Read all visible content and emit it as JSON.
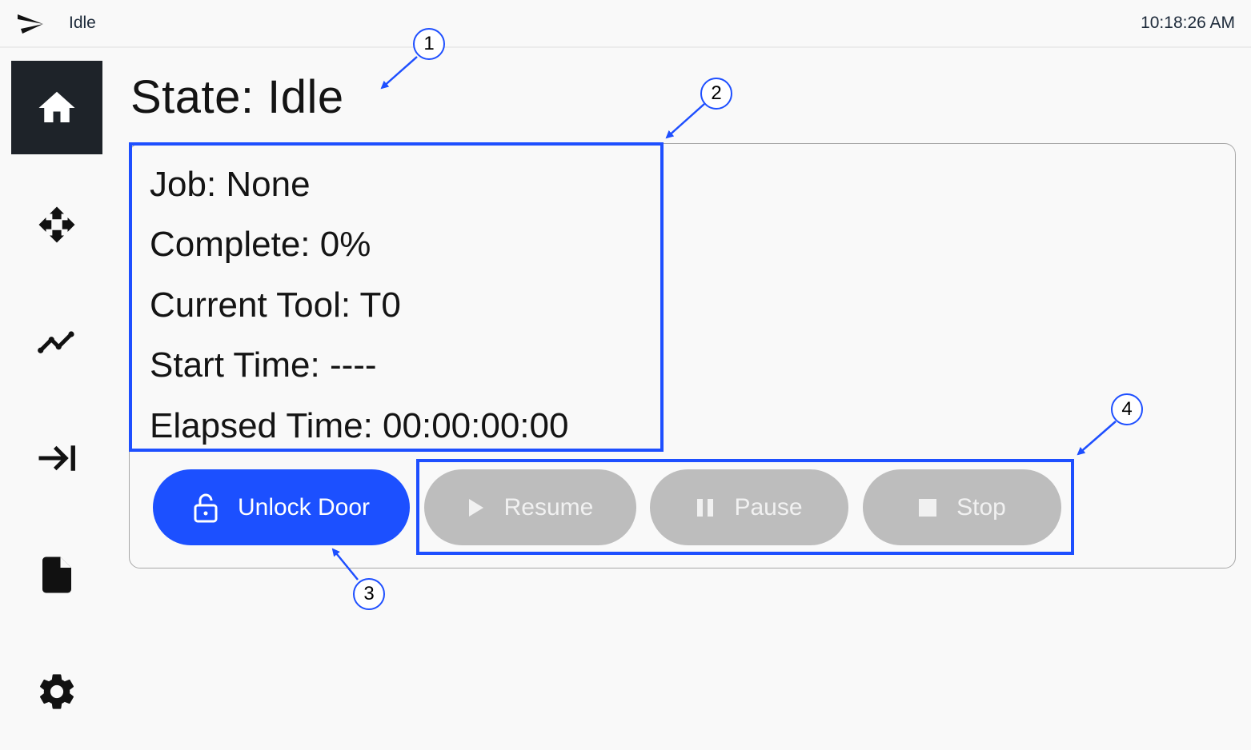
{
  "topbar": {
    "logo_icon": "paper-plane-logo-icon",
    "status": "Idle",
    "clock": "10:18:26 AM"
  },
  "sidebar": {
    "items": [
      {
        "name": "home",
        "icon": "home-icon",
        "active": true
      },
      {
        "name": "move",
        "icon": "move-arrows-icon",
        "active": false
      },
      {
        "name": "charts",
        "icon": "line-chart-icon",
        "active": false
      },
      {
        "name": "jog",
        "icon": "arrow-to-right-bar-icon",
        "active": false
      },
      {
        "name": "files",
        "icon": "file-icon",
        "active": false
      },
      {
        "name": "settings",
        "icon": "gear-icon",
        "active": false
      }
    ]
  },
  "main": {
    "title": "State: Idle",
    "info": {
      "job": "Job: None",
      "complete": "Complete: 0%",
      "current_tool": "Current Tool: T0",
      "start_time": "Start Time: ----",
      "elapsed_time": "Elapsed Time: 00:00:00:00"
    },
    "buttons": {
      "unlock_door": "Unlock Door",
      "resume": "Resume",
      "pause": "Pause",
      "stop": "Stop"
    }
  },
  "annotations": [
    "1",
    "2",
    "3",
    "4"
  ],
  "colors": {
    "accent": "#1c50ff",
    "annotation": "#1e4fff",
    "disabled": "#bdbdbd",
    "sidebar_active": "#1e2329"
  }
}
